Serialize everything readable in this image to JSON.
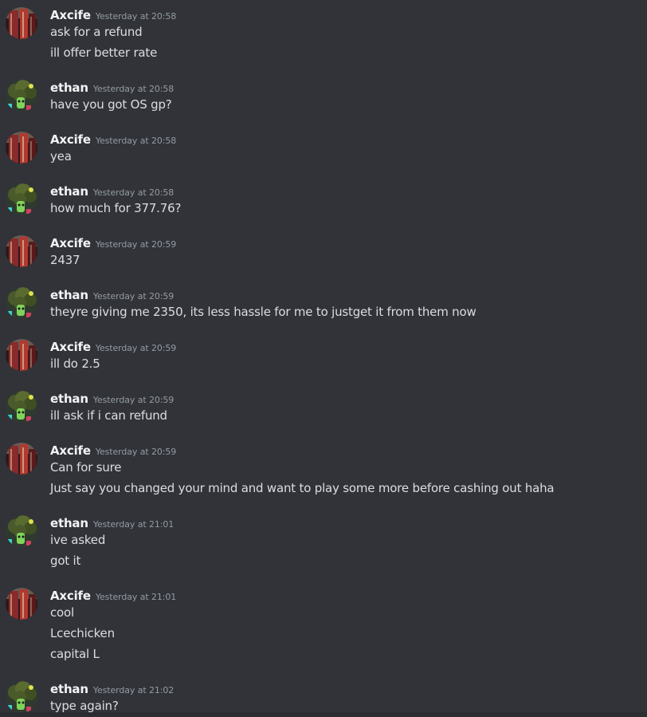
{
  "colors": {
    "background": "#313338",
    "username": "#f2f3f5",
    "timestamp": "#949ba4",
    "message_text": "#dbdee1"
  },
  "messages": [
    {
      "author": "Axcife",
      "avatar": "building-avatar-icon",
      "timestamp": "Yesterday at 20:58",
      "lines": [
        "ask for a refund",
        "ill offer better rate"
      ]
    },
    {
      "author": "ethan",
      "avatar": "broccoli-avatar-icon",
      "timestamp": "Yesterday at 20:58",
      "lines": [
        "have you got OS gp?"
      ]
    },
    {
      "author": "Axcife",
      "avatar": "building-avatar-icon",
      "timestamp": "Yesterday at 20:58",
      "lines": [
        "yea"
      ]
    },
    {
      "author": "ethan",
      "avatar": "broccoli-avatar-icon",
      "timestamp": "Yesterday at 20:58",
      "lines": [
        "how much for 377.76?"
      ]
    },
    {
      "author": "Axcife",
      "avatar": "building-avatar-icon",
      "timestamp": "Yesterday at 20:59",
      "lines": [
        "2437"
      ]
    },
    {
      "author": "ethan",
      "avatar": "broccoli-avatar-icon",
      "timestamp": "Yesterday at 20:59",
      "lines": [
        "theyre giving me 2350, its less hassle for me to justget it from them now"
      ]
    },
    {
      "author": "Axcife",
      "avatar": "building-avatar-icon",
      "timestamp": "Yesterday at 20:59",
      "lines": [
        "ill do 2.5"
      ]
    },
    {
      "author": "ethan",
      "avatar": "broccoli-avatar-icon",
      "timestamp": "Yesterday at 20:59",
      "lines": [
        "ill ask if i can refund"
      ]
    },
    {
      "author": "Axcife",
      "avatar": "building-avatar-icon",
      "timestamp": "Yesterday at 20:59",
      "lines": [
        "Can for sure",
        "Just say you changed your mind and want to play some more before cashing out haha"
      ]
    },
    {
      "author": "ethan",
      "avatar": "broccoli-avatar-icon",
      "timestamp": "Yesterday at 21:01",
      "lines": [
        "ive asked",
        "got it"
      ]
    },
    {
      "author": "Axcife",
      "avatar": "building-avatar-icon",
      "timestamp": "Yesterday at 21:01",
      "lines": [
        "cool",
        "Lcechicken",
        "capital L"
      ]
    },
    {
      "author": "ethan",
      "avatar": "broccoli-avatar-icon",
      "timestamp": "Yesterday at 21:02",
      "lines": [
        "type again?"
      ]
    }
  ]
}
